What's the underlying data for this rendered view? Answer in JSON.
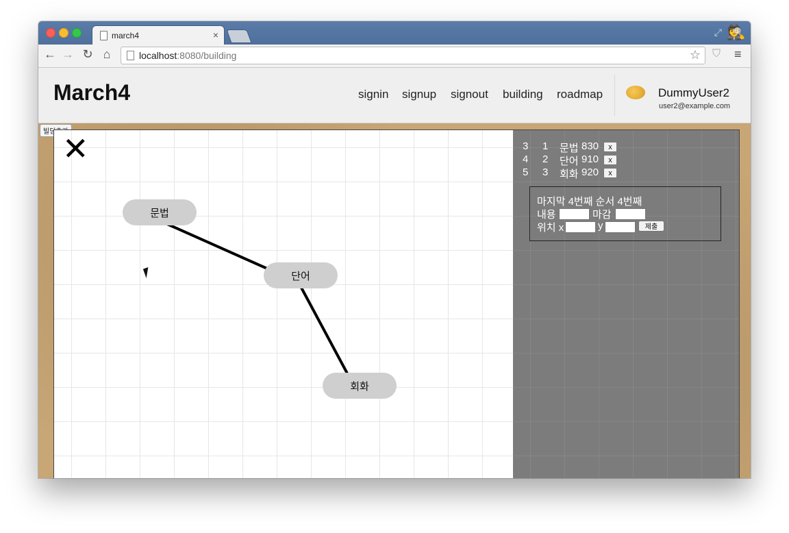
{
  "browser": {
    "tab_title": "march4",
    "tab_close": "×",
    "url_host": "localhost",
    "url_rest": ":8080/building"
  },
  "header": {
    "brand": "March4",
    "nav": [
      "signin",
      "signup",
      "signout",
      "building",
      "roadmap"
    ],
    "user_name": "DummyUser2",
    "user_email": "user2@example.com"
  },
  "add_button_label": "빌딩추가",
  "modal": {
    "close_label": "✕",
    "nodes": [
      {
        "label": "문법"
      },
      {
        "label": "단어"
      },
      {
        "label": "회화"
      }
    ],
    "list": [
      {
        "id": "3",
        "order": "1",
        "content": "문법",
        "deadline": "830",
        "delete_label": "x"
      },
      {
        "id": "4",
        "order": "2",
        "content": "단어",
        "deadline": "910",
        "delete_label": "x"
      },
      {
        "id": "5",
        "order": "3",
        "content": "회화",
        "deadline": "920",
        "delete_label": "x"
      }
    ],
    "form": {
      "status_line": "마지막 4번째 순서 4번째",
      "content_label": "내용",
      "deadline_label": "마감",
      "position_label": "위치 x",
      "y_label": "y",
      "submit_label": "제출"
    }
  }
}
